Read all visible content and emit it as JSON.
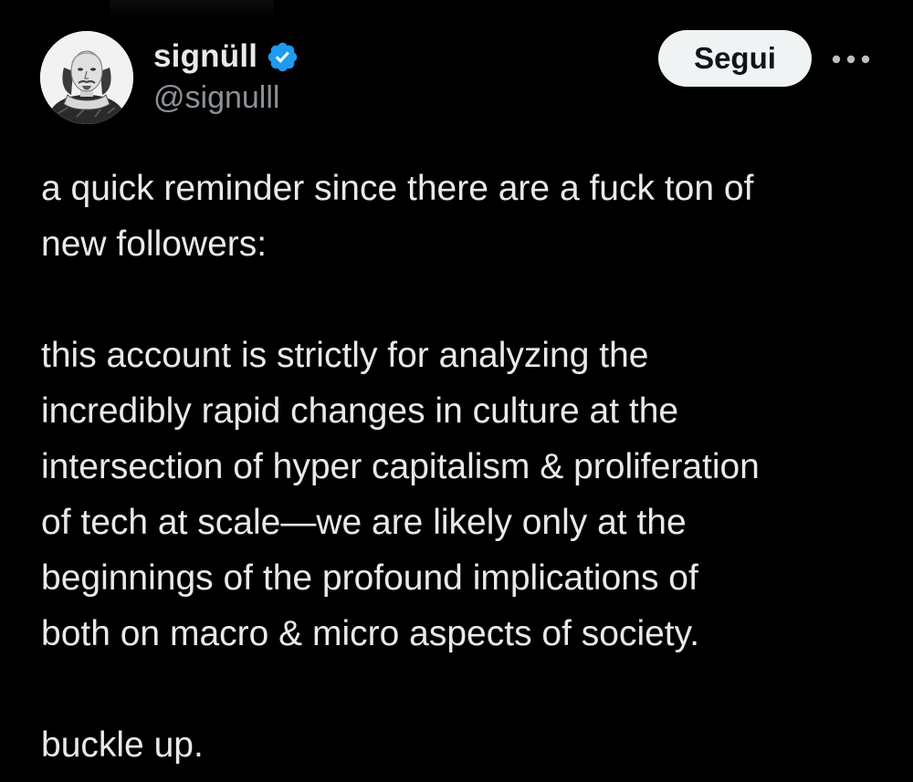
{
  "author": {
    "display_name": "signüll",
    "handle": "@signulll",
    "verified": true,
    "verified_icon": "verified-badge-icon",
    "avatar_icon": "shakespeare-portrait-avatar"
  },
  "actions": {
    "follow_label": "Segui",
    "more_icon": "more-options-icon"
  },
  "tweet": {
    "text": "a quick reminder since there are a fuck ton of\nnew followers:\n\nthis account is strictly for analyzing the\nincredibly rapid changes in culture at the\nintersection of hyper capitalism & proliferation\nof tech at scale—we are likely only at the\nbeginnings of the profound implications of\nboth on macro & micro aspects of society.\n\nbuckle up."
  },
  "colors": {
    "background": "#000000",
    "primary_text": "#e7e9ea",
    "secondary_text": "#8b9197",
    "verified_blue": "#1d9bf0",
    "follow_button_bg": "#eff3f4",
    "follow_button_text": "#0f1419"
  }
}
